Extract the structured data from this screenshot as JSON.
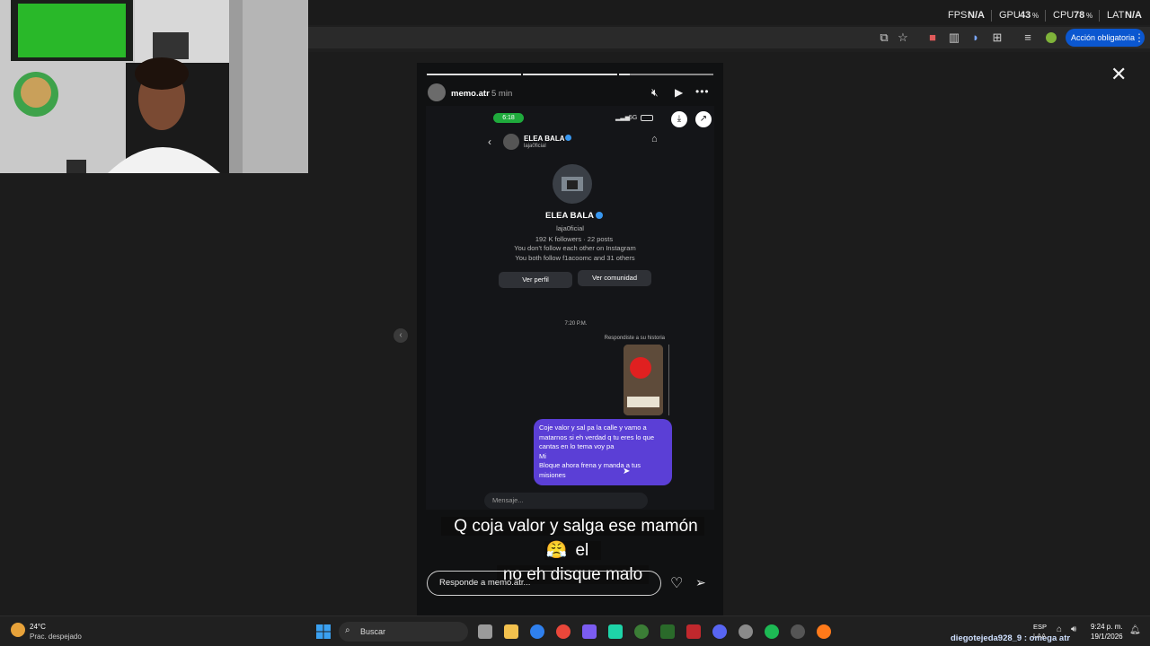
{
  "overlay_stats": {
    "fps_label": "FPS",
    "fps_value": "N/A",
    "gpu_label": "GPU",
    "gpu_value": "43",
    "cpu_label": "CPU",
    "cpu_value": "78",
    "lat_label": "LAT",
    "lat_value": "N/A",
    "unit": "%"
  },
  "browser": {
    "cta_label": "Acción obligatoria"
  },
  "story": {
    "username": "memo.atr",
    "time_ago": "5 min",
    "subtitle_line1": "Q coja valor y salga ese mamón",
    "subtitle_line2": "el",
    "subtitle_line3": "no eh disque malo",
    "reply_placeholder": "Responde a memo.atr..."
  },
  "screenshot": {
    "status_time": "6:18",
    "network": "5G",
    "header_name": "ELEA BALA",
    "header_handle": "laja0ficial",
    "profile_name": "ELEA BALA",
    "profile_handle": "laja0ficial",
    "profile_stats": "192 K followers · 22 posts",
    "profile_line2": "You don't follow each other on Instagram",
    "profile_line3": "You both follow f1acoomc and 31 others",
    "btn_profile": "Ver perfil",
    "btn_community": "Ver comunidad",
    "chat_time": "7:20 P.M.",
    "replied_label": "Respondiste a su historia",
    "message_lines": [
      "Coje valor y sal pa la calle y vamo a",
      "matarnos si eh verdad q tu eres lo que",
      "cantas en lo tema voy pa",
      "Mi",
      "Bloque ahora frena y manda a tus",
      "misiones"
    ],
    "input_placeholder": "Mensaje..."
  },
  "taskbar": {
    "weather_temp": "24°C",
    "weather_desc": "Prac. despejado",
    "search_label": "Buscar",
    "lang": "ESP",
    "lang_sub": "LAA",
    "clock_time": "9:24 p. m.",
    "clock_date": "19/1/2026",
    "stream_credit": "diegotejeda928_9 : omega atr",
    "accent": "#0b57d0",
    "bubble_color": "#5b3fd6"
  }
}
